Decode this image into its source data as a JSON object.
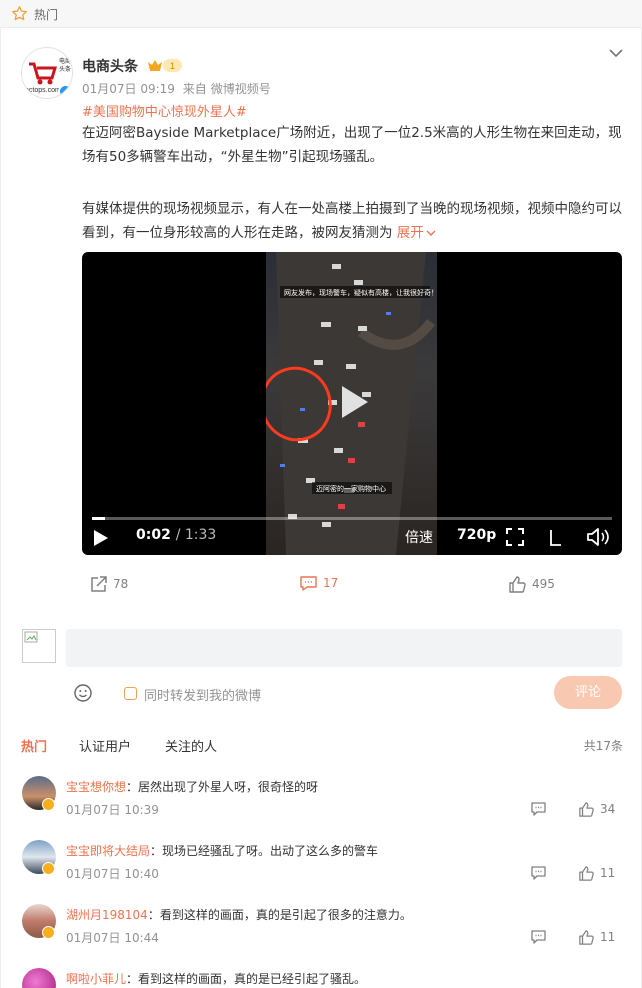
{
  "header": {
    "title": "热门"
  },
  "post": {
    "author": "电商头条",
    "avatar_text": "ectops.com",
    "avatar_logo_text": "电商头条",
    "level_badge": "1",
    "time": "01月07日 09:19",
    "source_prefix": "来自",
    "source": "微博视频号",
    "hashtag": "#美国购物中心惊现外星人#",
    "paragraph1": "在迈阿密Bayside Marketplace广场附近，出现了一位2.5米高的人形生物在来回走动，现场有50多辆警车出动，“外星生物”引起现场骚乱。",
    "paragraph2": "有媒体提供的现场视频显示，有人在一处高楼上拍摄到了当晚的现场视频，视频中隐约可以看到，有一位身形较高的人形在走路，被网友猜测为",
    "expand_label": "展开",
    "video": {
      "current_time": "0:02",
      "duration": "/ 1:33",
      "progress": 0.025,
      "speed_label": "倍速",
      "quality_label": "720p",
      "overlay_top": "网友发布，现场警车，疑似有高楼，让我很好奇！",
      "overlay_bottom": "迈阿密的一家购物中心"
    },
    "actions": {
      "reposts": "78",
      "comments": "17",
      "likes": "495"
    }
  },
  "comment_box": {
    "placeholder": "",
    "repost_label": "同时转发到我的微博",
    "submit_label": "评论"
  },
  "tabs": [
    "热门",
    "认证用户",
    "关注的人"
  ],
  "total": "共17条",
  "comments": [
    {
      "name": "宝宝想你想",
      "text": "：居然出现了外星人呀，很奇怪的呀",
      "time": "01月07日 10:39",
      "likes": "34"
    },
    {
      "name": "宝宝即将大结局",
      "text": "：现场已经骚乱了呀。出动了这么多的警车",
      "time": "01月07日 10:40",
      "likes": "11"
    },
    {
      "name": "湖州月198104",
      "text": "：看到这样的画面，真的是引起了很多的注意力。",
      "time": "01月07日 10:44",
      "likes": "11"
    },
    {
      "name": "啊啦小菲儿",
      "text": "：看到这样的画面，真的是已经引起了骚乱。",
      "time": "",
      "likes": ""
    }
  ],
  "colors": {
    "accent": "#eb7350",
    "link": "#eb7350",
    "submit_disabled": "#f9c8b0"
  }
}
